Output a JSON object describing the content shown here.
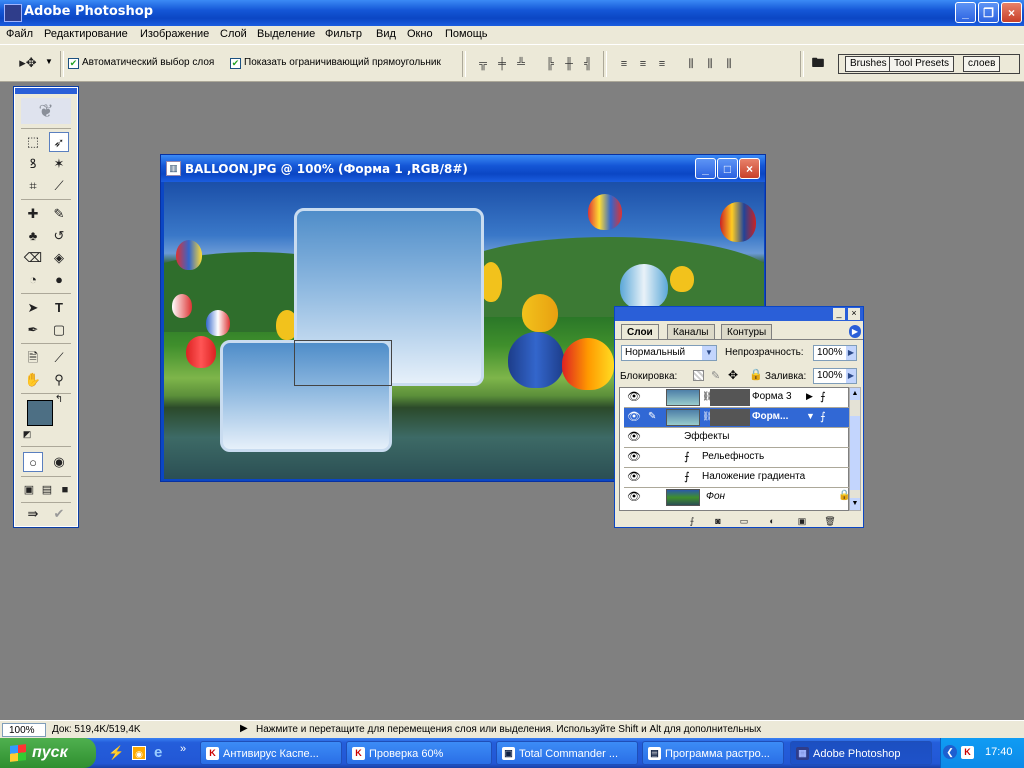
{
  "app": {
    "title": "Adobe Photoshop",
    "window_controls": [
      "_",
      "❐",
      "×"
    ]
  },
  "menu": [
    "Файл",
    "Редактирование",
    "Изображение",
    "Слой",
    "Выделение",
    "Фильтр",
    "Вид",
    "Окно",
    "Помощь"
  ],
  "options": {
    "auto_select_label": "Автоматический выбор слоя",
    "auto_select_checked": true,
    "show_bounds_label": "Показать ограничивающий прямоугольник",
    "show_bounds_checked": true,
    "align_icons": [
      "align-top-icon",
      "align-vcenter-icon",
      "align-bottom-icon",
      "align-left-icon",
      "align-hcenter-icon",
      "align-right-icon",
      "distribute-top-icon",
      "distribute-vcenter-icon",
      "distribute-bottom-icon",
      "distribute-left-icon",
      "distribute-hcenter-icon",
      "distribute-right-icon"
    ],
    "palette_well_tabs": [
      "Brushes",
      "Tool Presets",
      "слоев"
    ]
  },
  "colors": {
    "foreground": "#4d6f84",
    "background": "#5b6126",
    "xp_blue": "#0b46c4",
    "selection": "#3168d5"
  },
  "document": {
    "title": "BALLOON.JPG @ 100% (Форма 1 ,RGB/8#)"
  },
  "layers_panel": {
    "tabs": [
      "Слои",
      "Каналы",
      "Контуры"
    ],
    "active_tab": "Слои",
    "blend_mode": "Нормальный",
    "opacity_label": "Непрозрачность:",
    "opacity_value": "100%",
    "lock_label": "Блокировка:",
    "fill_label": "Заливка:",
    "fill_value": "100%",
    "layers": [
      {
        "name": "Форма 3",
        "selected": false
      },
      {
        "name": "Форм...",
        "selected": true
      },
      {
        "name": "Эффекты",
        "type": "effects-header"
      },
      {
        "name": "Рельефность",
        "type": "effect"
      },
      {
        "name": "Наложение градиента",
        "type": "effect"
      },
      {
        "name": "Фон",
        "locked": true
      }
    ]
  },
  "status": {
    "zoom": "100%",
    "doc_info": "Док: 519,4K/519,4K",
    "hint": "Нажмите и перетащите для перемещения слоя или выделения. Используйте Shift и Alt для дополнительных"
  },
  "taskbar": {
    "start_label": "пуск",
    "tasks": [
      {
        "label": "Антивирус Каспе...",
        "active": false
      },
      {
        "label": "Проверка 60%",
        "active": false
      },
      {
        "label": "Total Commander ...",
        "active": false
      },
      {
        "label": "Программа растро...",
        "active": false
      },
      {
        "label": "Adobe Photoshop",
        "active": true
      }
    ],
    "clock": "17:40"
  }
}
